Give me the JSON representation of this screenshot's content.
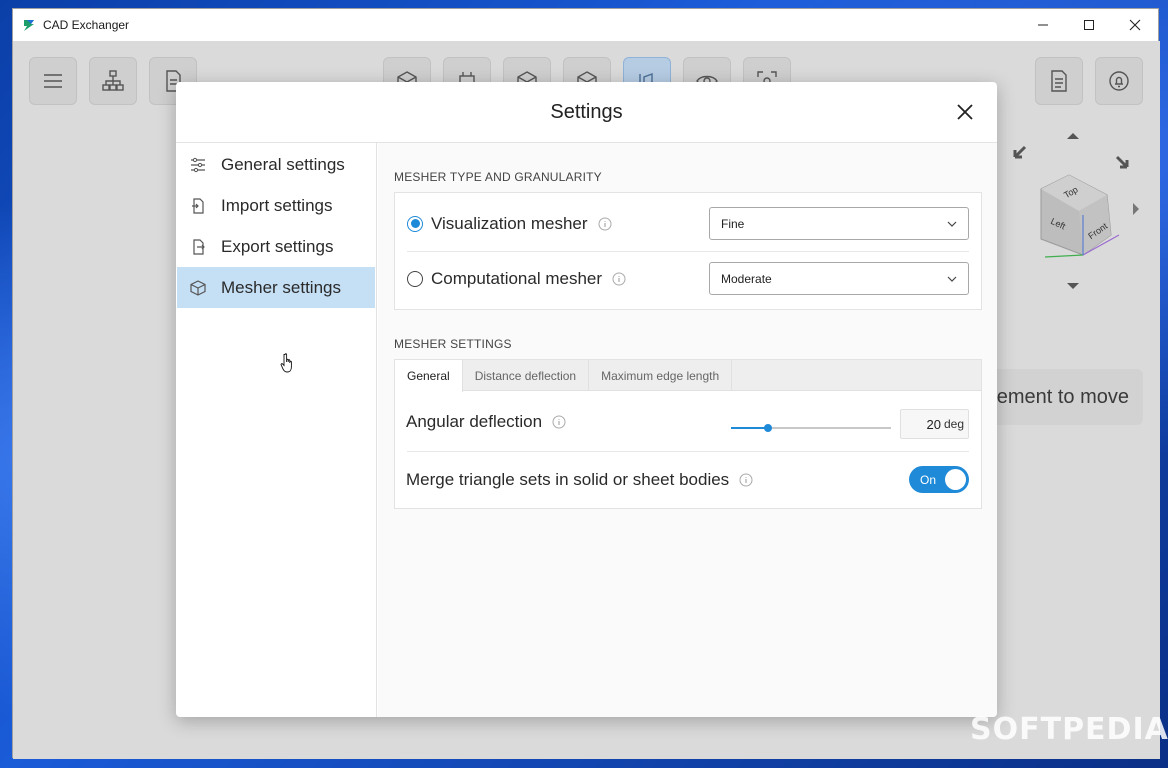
{
  "window": {
    "title": "CAD Exchanger"
  },
  "controls": {
    "minimize": "—",
    "maximize": "☐",
    "close": "✕"
  },
  "background": {
    "hint_text": "ement to move",
    "watermark": "SOFTPEDIA"
  },
  "viewcube": {
    "faces": [
      "Top",
      "Front",
      "Left"
    ]
  },
  "dialog": {
    "title": "Settings",
    "nav": [
      {
        "label": "General settings",
        "icon": "sliders-icon"
      },
      {
        "label": "Import settings",
        "icon": "import-icon"
      },
      {
        "label": "Export settings",
        "icon": "export-icon"
      },
      {
        "label": "Mesher settings",
        "icon": "mesh-cube-icon",
        "active": true
      }
    ],
    "mesher_type": {
      "section_title": "MESHER TYPE AND GRANULARITY",
      "options": [
        {
          "label": "Visualization mesher",
          "checked": true,
          "granularity": "Fine"
        },
        {
          "label": "Computational mesher",
          "checked": false,
          "granularity": "Moderate"
        }
      ]
    },
    "mesher_settings": {
      "section_title": "MESHER SETTINGS",
      "tabs": [
        "General",
        "Distance deflection",
        "Maximum edge length"
      ],
      "active_tab": "General",
      "angular_deflection": {
        "label": "Angular deflection",
        "value": "20",
        "unit": "deg",
        "slider_fraction": 0.23
      },
      "merge": {
        "label": "Merge triangle sets in solid or sheet bodies",
        "toggle": "On"
      }
    }
  },
  "colors": {
    "accent": "#1f8ad8",
    "nav_active": "#c5dff5"
  }
}
